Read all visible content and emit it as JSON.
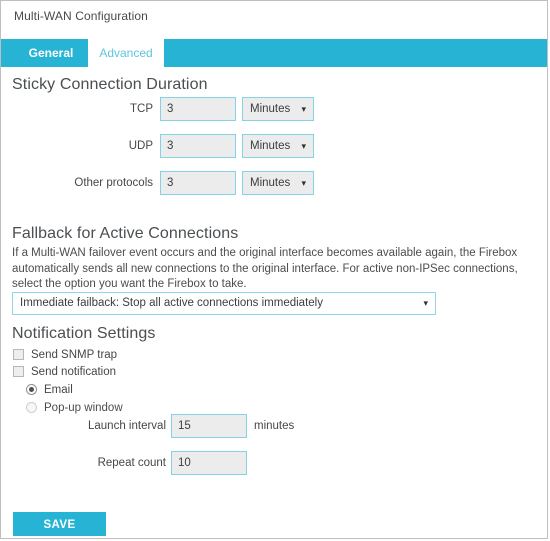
{
  "window": {
    "title": "Multi-WAN Configuration"
  },
  "tabs": [
    {
      "label": "General",
      "active": false
    },
    {
      "label": "Advanced",
      "active": true
    }
  ],
  "sticky_section": {
    "heading": "Sticky Connection Duration",
    "rows": [
      {
        "label": "TCP",
        "value": "3",
        "unit": "Minutes"
      },
      {
        "label": "UDP",
        "value": "3",
        "unit": "Minutes"
      },
      {
        "label": "Other protocols",
        "value": "3",
        "unit": "Minutes"
      }
    ]
  },
  "fallback_section": {
    "heading": "Fallback for Active Connections",
    "description": "If a Multi-WAN failover event occurs and the original interface becomes available again, the Firebox automatically sends all new connections to the original interface. For active non-IPSec connections, select the option you want the Firebox to take.",
    "selected_option": "Immediate failback: Stop all active connections immediately"
  },
  "notification_section": {
    "heading": "Notification Settings",
    "checkboxes": [
      {
        "label": "Send SNMP trap",
        "checked": false
      },
      {
        "label": "Send notification",
        "checked": false
      }
    ],
    "radios": [
      {
        "label": "Email",
        "selected": true
      },
      {
        "label": "Pop-up window",
        "selected": false
      }
    ],
    "launch_interval": {
      "label": "Launch interval",
      "value": "15",
      "unit": "minutes"
    },
    "repeat_count": {
      "label": "Repeat count",
      "value": "10"
    }
  },
  "footer": {
    "save_label": "SAVE"
  },
  "colors": {
    "accent": "#27b4d4",
    "field_border": "#84d2e6",
    "field_fill": "#ececec",
    "text": "#44474a"
  },
  "icons": {
    "caret": "▾"
  }
}
